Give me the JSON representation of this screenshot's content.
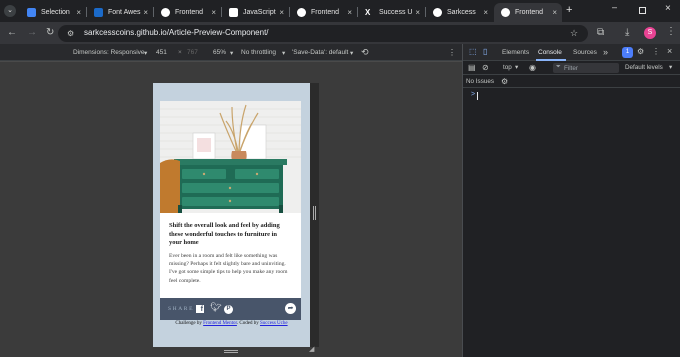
{
  "tabs": [
    {
      "label": "Selection",
      "fav_color": "#4285f4"
    },
    {
      "label": "Font Awes",
      "fav_color": "#1b6ac9"
    },
    {
      "label": "Frontend",
      "fav_color": "#ffffff"
    },
    {
      "label": "JavaScript",
      "fav_color": "#ffffff"
    },
    {
      "label": "Frontend",
      "fav_color": "#ffffff"
    },
    {
      "label": "Success U",
      "fav_color": "#000000"
    },
    {
      "label": "Sarkcess",
      "fav_color": "#ffffff"
    },
    {
      "label": "Frontend",
      "fav_color": "#ffffff"
    }
  ],
  "browser": {
    "url": "sarkcesscoins.github.io/Article-Preview-Component/",
    "avatar_letter": "S",
    "avatar_color": "#e84393"
  },
  "device_toolbar": {
    "dimensions": "Dimensions: Responsive",
    "width": "451",
    "times": "×",
    "height": "767",
    "zoom": "65%",
    "throttle": "No throttling",
    "save_data": "'Save-Data': default"
  },
  "article": {
    "title": "Shift the overall look and feel by adding these wonderful touches to furniture in your home",
    "description": "Ever been in a room and felt like something was missing? Perhaps it felt slightly bare and uninviting. I've got some simple tips to help you make any room feel complete.",
    "share_label": "SHARE",
    "attribution_prefix": "Challenge by ",
    "attribution_link1": "Frontend Mentor",
    "attribution_middle": ". Coded by ",
    "attribution_link2": "Success Uche"
  },
  "devtools": {
    "tab_elements": "Elements",
    "tab_console": "Console",
    "tab_sources": "Sources",
    "more": "»",
    "context": "top",
    "filter_placeholder": "Filter",
    "levels": "Default levels",
    "issues": "No Issues",
    "prompt": ">",
    "badge_count": "1"
  }
}
